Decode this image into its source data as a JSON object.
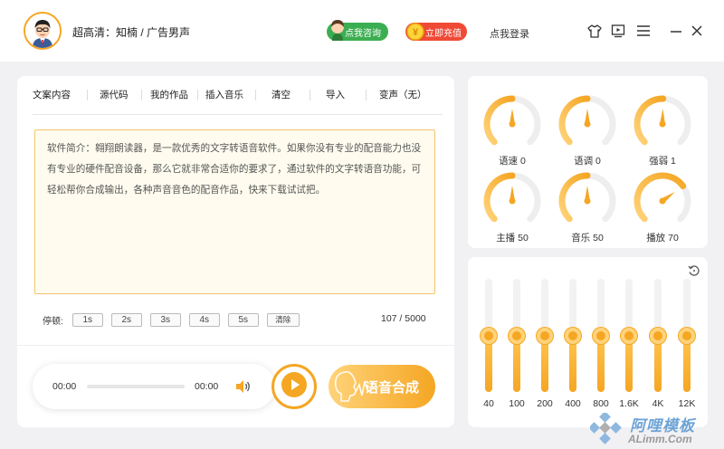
{
  "header": {
    "title": "超高清：知楠 / 广告男声",
    "consult_label": "点我咨询",
    "recharge_label": "立即充值",
    "login_label": "点我登录"
  },
  "tabs": [
    {
      "label": "文案内容"
    },
    {
      "label": "源代码"
    },
    {
      "label": "我的作品"
    },
    {
      "label": "插入音乐"
    },
    {
      "label": "清空"
    },
    {
      "label": "导入"
    },
    {
      "label": "变声（无）"
    }
  ],
  "editor": {
    "text": "软件简介：翱翔朗读器，是一款优秀的文字转语音软件。如果你没有专业的配音能力也没有专业的硬件配音设备，那么它就非常合适你的要求了，通过软件的文字转语音功能，可轻松帮你合成输出，各种声音音色的配音作品，快来下载试试把。"
  },
  "pause": {
    "label": "停顿:",
    "options": [
      "1s",
      "2s",
      "3s",
      "4s",
      "5s"
    ],
    "clear_label": "清除"
  },
  "char_count": "107 / 5000",
  "player": {
    "current_time": "00:00",
    "total_time": "00:00",
    "progress": 0
  },
  "synth_label": "语音合成",
  "dials": [
    {
      "label": "语速 0",
      "value": 0,
      "min": -100,
      "max": 100
    },
    {
      "label": "语调 0",
      "value": 0,
      "min": -100,
      "max": 100
    },
    {
      "label": "强弱 1",
      "value": 1,
      "min": -100,
      "max": 100
    },
    {
      "label": "主播 50",
      "value": 50,
      "min": 0,
      "max": 100
    },
    {
      "label": "音乐 50",
      "value": 50,
      "min": 0,
      "max": 100
    },
    {
      "label": "播放 70",
      "value": 70,
      "min": 0,
      "max": 100
    }
  ],
  "equalizer": {
    "bands": [
      {
        "label": "40",
        "level": 0.5
      },
      {
        "label": "100",
        "level": 0.5
      },
      {
        "label": "200",
        "level": 0.5
      },
      {
        "label": "400",
        "level": 0.5
      },
      {
        "label": "800",
        "level": 0.5
      },
      {
        "label": "1.6K",
        "level": 0.5
      },
      {
        "label": "4K",
        "level": 0.5
      },
      {
        "label": "12K",
        "level": 0.5
      }
    ]
  },
  "watermark": {
    "cn": "阿哩模板",
    "en": "ALimm.Com"
  },
  "colors": {
    "accent": "#f5a623",
    "accent_light": "#ffd37a",
    "consult_green": "#3cae52",
    "recharge_red": "#f04a37"
  },
  "icons": [
    "avatar",
    "consult-icon",
    "coin-icon",
    "skin-icon",
    "screen-icon",
    "menu-icon",
    "minimize-icon",
    "close-icon",
    "play-icon",
    "volume-icon",
    "reset-icon"
  ]
}
